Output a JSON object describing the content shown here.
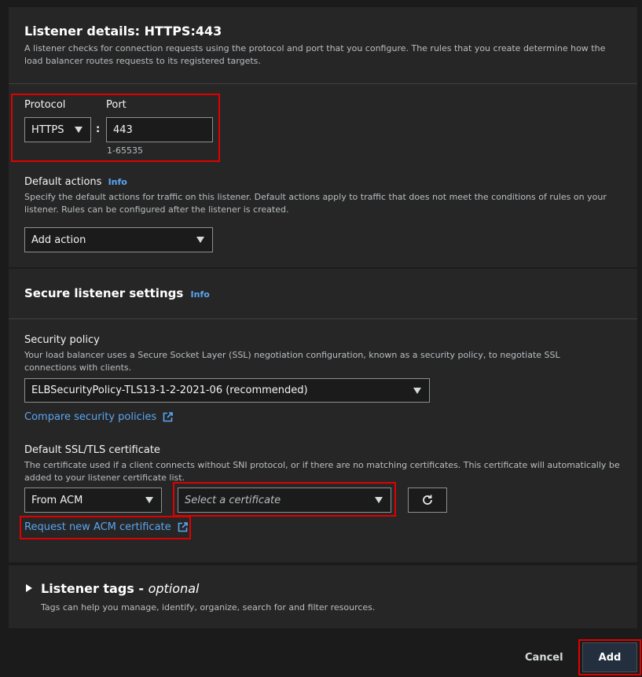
{
  "listener": {
    "title": "Listener details: HTTPS:443",
    "description": "A listener checks for connection requests using the protocol and port that you configure. The rules that you create determine how the load balancer routes requests to its registered targets.",
    "protocol_label": "Protocol",
    "protocol_value": "HTTPS",
    "colon": ":",
    "port_label": "Port",
    "port_value": "443",
    "port_hint": "1-65535",
    "default_actions_label": "Default actions",
    "default_actions_info": "Info",
    "default_actions_desc": "Specify the default actions for traffic on this listener. Default actions apply to traffic that does not meet the conditions of rules on your listener. Rules can be configured after the listener is created.",
    "add_action": "Add action"
  },
  "secure": {
    "title": "Secure listener settings",
    "info": "Info",
    "policy_label": "Security policy",
    "policy_desc": "Your load balancer uses a Secure Socket Layer (SSL) negotiation configuration, known as a security policy, to negotiate SSL connections with clients.",
    "policy_value": "ELBSecurityPolicy-TLS13-1-2-2021-06 (recommended)",
    "compare_link": "Compare security policies",
    "cert_label": "Default SSL/TLS certificate",
    "cert_desc": "The certificate used if a client connects without SNI protocol, or if there are no matching certificates. This certificate will automatically be added to your listener certificate list.",
    "cert_source": "From ACM",
    "cert_placeholder": "Select a certificate",
    "request_link": "Request new ACM certificate"
  },
  "tags": {
    "title": "Listener tags - ",
    "optional": "optional",
    "desc": "Tags can help you manage, identify, organize, search for and filter resources."
  },
  "footer": {
    "cancel": "Cancel",
    "add": "Add"
  },
  "colors": {
    "link": "#5aa6f2",
    "highlight": "#e00000",
    "panel": "#262626",
    "page": "#1b1b1b"
  }
}
